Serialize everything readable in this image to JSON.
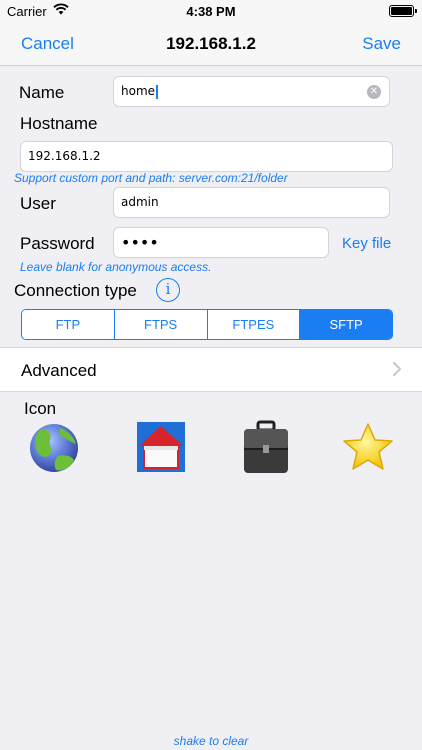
{
  "status_bar": {
    "carrier": "Carrier",
    "time": "4:38 PM",
    "icons": [
      "wifi-icon",
      "battery-icon"
    ]
  },
  "nav": {
    "cancel_label": "Cancel",
    "title": "192.168.1.2",
    "save_label": "Save"
  },
  "form": {
    "name_label": "Name",
    "name_value": "home",
    "hostname_label": "Hostname",
    "hostname_value": "192.168.1.2",
    "hostname_hint": "Support custom port and path: server.com:21/folder",
    "user_label": "User",
    "user_value": "admin",
    "password_label": "Password",
    "password_value": "••••",
    "key_file_label": "Key file",
    "password_hint": "Leave blank for anonymous access.",
    "connection_type_label": "Connection type",
    "connection_types": [
      "FTP",
      "FTPS",
      "FTPES",
      "SFTP"
    ],
    "selected_connection_type": "SFTP"
  },
  "advanced": {
    "label": "Advanced"
  },
  "icons_section": {
    "label": "Icon",
    "choices": [
      "globe-icon",
      "home-icon",
      "briefcase-icon",
      "star-icon"
    ]
  },
  "footer": {
    "hint": "shake to clear"
  },
  "colors": {
    "accent": "#1a7ef2",
    "background": "#efeff4"
  }
}
